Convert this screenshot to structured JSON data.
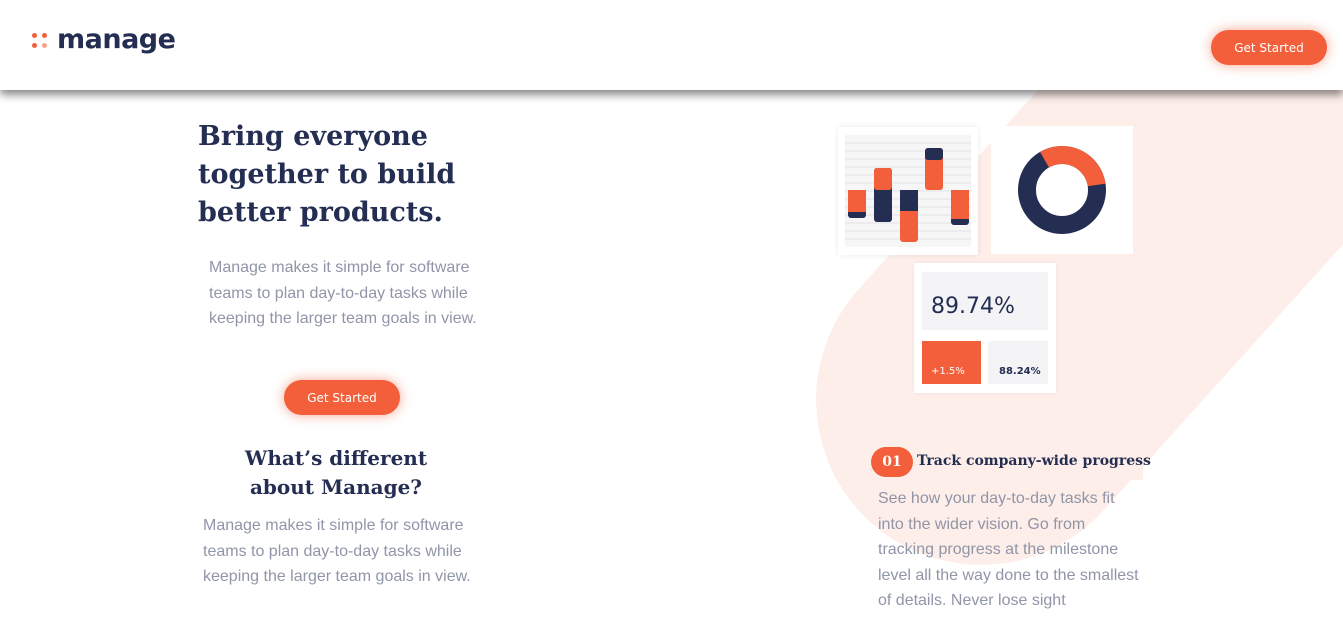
{
  "header": {
    "logo_text": "manage",
    "cta_label": "Get Started"
  },
  "hero": {
    "title": "Bring everyone together to build better products.",
    "description": "Manage makes it simple for software teams to plan day-to-day tasks while keeping the larger team goals in view.",
    "cta_label": "Get Started"
  },
  "difference": {
    "title": "What’s different about Manage?",
    "description": "Manage makes it simple for software teams to plan day-to-day tasks while keeping the larger team goals in view."
  },
  "illustration": {
    "stat_main": "89.74%",
    "stat_change": "+1.5%",
    "stat_secondary": "88.24%"
  },
  "features": [
    {
      "number": "01",
      "title": "Track company-wide progress",
      "description": "See how your day-to-day tasks fit into the wider vision. Go from tracking progress at the milestone level all the way done to the smallest of details. Never lose sight"
    }
  ],
  "colors": {
    "accent": "#f25f3a",
    "navy": "#242d52",
    "muted_text": "#9095a7",
    "pale_accent": "#fdeee9"
  }
}
